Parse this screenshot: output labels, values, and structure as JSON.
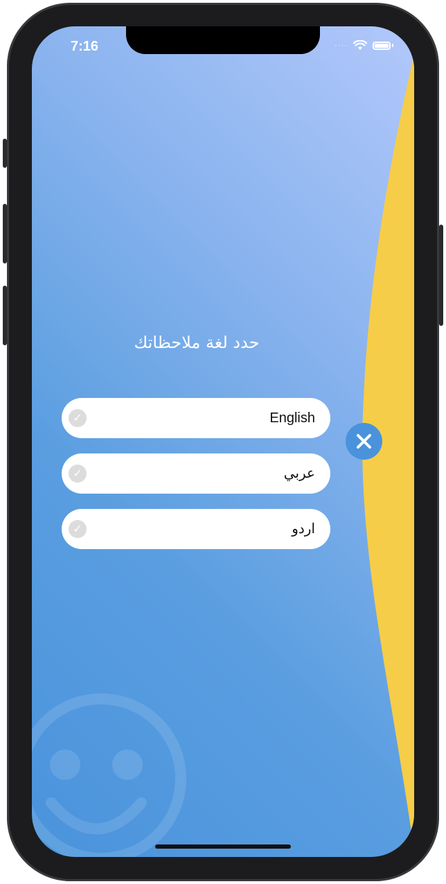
{
  "status_bar": {
    "time": "7:16",
    "signal": "····"
  },
  "prompt": {
    "title": "حدد لغة ملاحظاتك"
  },
  "languages": [
    {
      "label": "English"
    },
    {
      "label": "عربي"
    },
    {
      "label": "اردو"
    }
  ],
  "icons": {
    "close": "close-icon",
    "check": "checkmark-icon",
    "wifi": "wifi-icon",
    "battery": "battery-icon",
    "smiley": "smiley-icon"
  },
  "colors": {
    "accent_blue": "#4a93dc",
    "wave_yellow": "#f6cd48",
    "check_gray": "#dcdcdc"
  }
}
